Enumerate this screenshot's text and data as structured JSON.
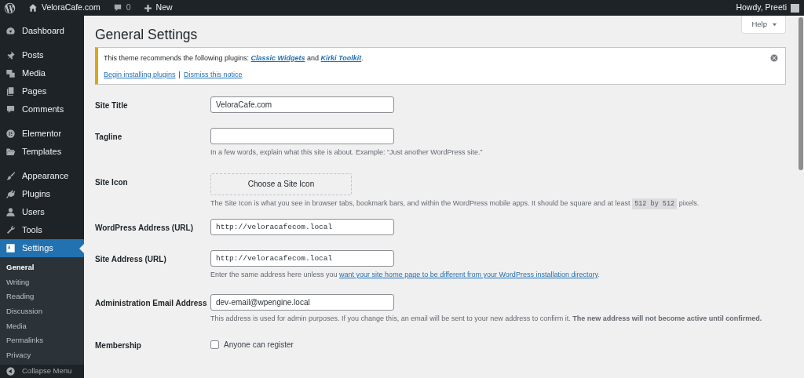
{
  "admin_bar": {
    "site_name": "VeloraCafe.com",
    "comments_count": "0",
    "new_label": "New",
    "greeting": "Howdy, Preeti"
  },
  "sidebar": {
    "groups": [
      {
        "items": [
          {
            "label": "Dashboard",
            "selected": false
          }
        ]
      },
      {
        "items": [
          {
            "label": "Posts",
            "selected": false
          },
          {
            "label": "Media",
            "selected": false
          },
          {
            "label": "Pages",
            "selected": false
          },
          {
            "label": "Comments",
            "selected": false
          }
        ]
      },
      {
        "items": [
          {
            "label": "Elementor",
            "selected": false
          },
          {
            "label": "Templates",
            "selected": false
          }
        ]
      },
      {
        "items": [
          {
            "label": "Appearance",
            "selected": false
          },
          {
            "label": "Plugins",
            "selected": false
          },
          {
            "label": "Users",
            "selected": false
          },
          {
            "label": "Tools",
            "selected": false
          },
          {
            "label": "Settings",
            "selected": true,
            "submenu": [
              {
                "label": "General",
                "selected": true
              },
              {
                "label": "Writing",
                "selected": false
              },
              {
                "label": "Reading",
                "selected": false
              },
              {
                "label": "Discussion",
                "selected": false
              },
              {
                "label": "Media",
                "selected": false
              },
              {
                "label": "Permalinks",
                "selected": false
              },
              {
                "label": "Privacy",
                "selected": false
              }
            ]
          }
        ]
      }
    ],
    "collapse_label": "Collapse Menu"
  },
  "page": {
    "title": "General Settings",
    "help_label": "Help",
    "notice": {
      "message": [
        {
          "kind": "text",
          "text": "This theme recommends the following plugins: "
        },
        {
          "kind": "link",
          "text": "Classic Widgets"
        },
        {
          "kind": "text",
          "text": " and "
        },
        {
          "kind": "link",
          "text": "Kirki Toolkit"
        },
        {
          "kind": "text",
          "text": "."
        }
      ],
      "actions": [
        "Begin installing plugins",
        "Dismiss this notice"
      ],
      "separator": "|"
    },
    "fields": [
      {
        "kind": "text",
        "label": "Site Title",
        "value": "VeloraCafe.com"
      },
      {
        "kind": "text",
        "label": "Tagline",
        "description": [
          {
            "kind": "text",
            "text": "In a few words, explain what this site is about. Example: “Just another WordPress site.”"
          }
        ]
      },
      {
        "kind": "button",
        "label": "Site Icon",
        "value": "Choose a Site Icon",
        "description": [
          {
            "kind": "text",
            "text": "The Site Icon is what you see in browser tabs, bookmark bars, and within the WordPress mobile apps. It should be square and at least "
          },
          {
            "kind": "code",
            "text": "512 by 512"
          },
          {
            "kind": "text",
            "text": " pixels."
          }
        ]
      },
      {
        "kind": "url",
        "label": "WordPress Address (URL)",
        "value": "http://veloracafecom.local"
      },
      {
        "kind": "url",
        "label": "Site Address (URL)",
        "value": "http://veloracafecom.local",
        "description": [
          {
            "kind": "text",
            "text": "Enter the same address here unless you "
          },
          {
            "kind": "link",
            "text": "want your site home page to be different from your WordPress installation directory"
          },
          {
            "kind": "text",
            "text": "."
          }
        ]
      },
      {
        "kind": "text",
        "label": "Administration Email Address",
        "value": "dev-email@wpengine.local",
        "description": [
          {
            "kind": "text",
            "text": "This address is used for admin purposes. If you change this, an email will be sent to your new address to confirm it. **The new address will not become active until confirmed.**"
          }
        ]
      },
      {
        "kind": "checkbox",
        "label": "Membership",
        "value": "Anyone can register",
        "checked": false
      }
    ]
  }
}
